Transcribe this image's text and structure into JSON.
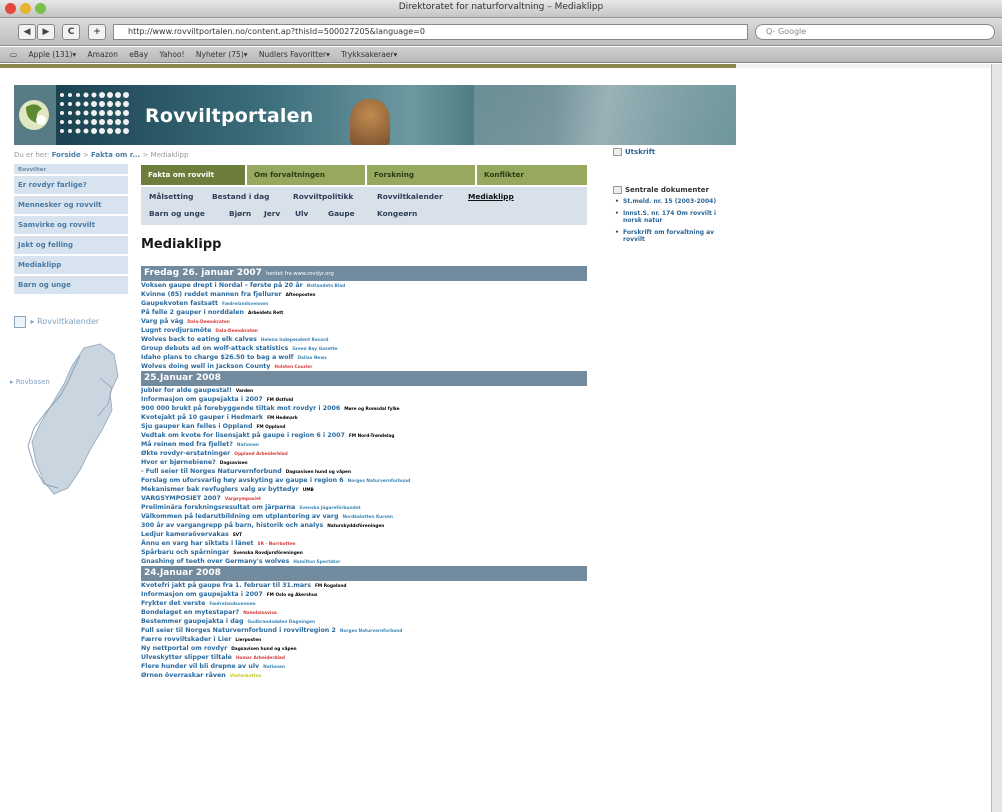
{
  "window": {
    "title": "Direktoratet for naturforvaltning – Mediaklipp"
  },
  "toolbar": {
    "back": "◀",
    "forward": "▶",
    "reload": "C",
    "add": "+",
    "url": "http://www.rovviltportalen.no/content.ap?thisId=500027205&language=0",
    "search_placeholder": "Q- Google"
  },
  "bookmarks": [
    "Apple (131)▾",
    "Amazon",
    "eBay",
    "Yahoo!",
    "Nyheter (75)▾",
    "Nudlers Favoritter▾",
    "Trykksakeraer▾"
  ],
  "banner": {
    "title": "Rovviltportalen"
  },
  "breadcrumb": {
    "prefix": "Du er her:",
    "home": "Forside",
    "sep1": " > ",
    "section": "Fakta om r...",
    "sep2": " > ",
    "current": "Mediaklipp"
  },
  "leftnav": {
    "small": "Rovvilter",
    "items": [
      "Er rovdyr farlige?",
      "Mennesker og rovvilt",
      "Samvirke og rovvilt",
      "Jakt og felling",
      "Mediaklipp",
      "Barn og unge"
    ]
  },
  "side": {
    "rovviltkalender": "Rovviltkalender",
    "rovbasen": "Rovbasen"
  },
  "tabs": [
    "Fakta om rovvilt",
    "Om forvaltningen",
    "Forskning",
    "Konflikter"
  ],
  "subtabs": {
    "row1": [
      "Målsetting",
      "Bestand i dag",
      "Rovviltpolitikk",
      "Rovviltkalender",
      "Mediaklipp"
    ],
    "row2": [
      "Barn og unge",
      "Bjørn",
      "Jerv",
      "Ulv",
      "Gaupe",
      "Kongeørn"
    ]
  },
  "main": {
    "title": "Mediaklipp"
  },
  "groups": [
    {
      "date": "Fredag 26. januar 2007",
      "source": "hentet fra www.rovdyr.org",
      "items": [
        {
          "t": "Voksen gaupe drept i Nordal – første på 20 år",
          "s": "Østlandets Blad",
          "c": "#3a86b4"
        },
        {
          "t": "Kvinne (85) reddet mannen fra fjellurer",
          "s": "Aftenposten",
          "c": "#000"
        },
        {
          "t": "Gaupekvoten fastsatt",
          "s": "Fædrelandsvennen",
          "c": "#3a86b4"
        },
        {
          "t": "På felle 2 gauper i norddalen",
          "s": "Arbeidets Rett",
          "c": "#000"
        },
        {
          "t": "Varg på väg",
          "s": "Dala-Demokraten",
          "c": "#d53a3a"
        },
        {
          "t": "Lugnt rovdjursmöte",
          "s": "Dala-Demokraten",
          "c": "#d53a3a"
        },
        {
          "t": "Wolves back to eating elk calves",
          "s": "Helena Independent Record",
          "c": "#3a86b4"
        },
        {
          "t": "Group debuts ad on wolf-attack statistics",
          "s": "Green Bay Gazette",
          "c": "#3a86b4"
        },
        {
          "t": "Idaho plans to charge $26.50 to bag a wolf",
          "s": "Dallas News",
          "c": "#3a86b4"
        },
        {
          "t": "Wolves doing well in Jackson County",
          "s": "Holsten Courier",
          "c": "#d53a3a"
        }
      ]
    },
    {
      "date": "25.Januar 2008",
      "source": "",
      "items": [
        {
          "t": "Jubler for alde gaupestal!",
          "s": "Varden",
          "c": "#000"
        },
        {
          "t": "Informasjon om gaupejakta i 2007",
          "s": "FM Østfold",
          "c": "#000"
        },
        {
          "t": "900 000 brukt på forebyggende tiltak mot rovdyr i 2006",
          "s": "Møre og Romsdal fylke",
          "c": "#000"
        },
        {
          "t": "Kvotejakt på 10 gauper i Hedmark",
          "s": "FM Hedmark",
          "c": "#000"
        },
        {
          "t": "Sju gauper kan felles i Oppland",
          "s": "FM Oppland",
          "c": "#000"
        },
        {
          "t": "Vedtak om kvote for lisensjakt på gaupe i region 6 i 2007",
          "s": "FM Nord-Trøndelag",
          "c": "#000"
        },
        {
          "t": "Må reinen med fra fjellet?",
          "s": "Nationen",
          "c": "#3a86b4"
        },
        {
          "t": "Økte rovdyr-erstatninger",
          "s": "Oppland Arbeiderblad",
          "c": "#d53a3a"
        },
        {
          "t": "Hvor er bjørnebiene?",
          "s": "Dagsavisen",
          "c": "#000"
        },
        {
          "t": "- Full seier til Norges Naturvernforbund",
          "s": "Dagsavisen hund og våpen",
          "c": "#000"
        },
        {
          "t": "Forslag om uforsvarlig høy avskyting av gaupe i region 6",
          "s": "Norges Naturvernforbund",
          "c": "#3a86b4"
        },
        {
          "t": "Mekanismer bak revfuglers valg av byttedyr",
          "s": "UMB",
          "c": "#000"
        },
        {
          "t": "VARGSYMPOSIET 2007",
          "s": "Vargsymposiet",
          "c": "#d53a3a"
        },
        {
          "t": "Preliminära forskningsresultat om järparna",
          "s": "Svenska Jägareförbundet",
          "c": "#3a86b4"
        },
        {
          "t": "Välkommen på ledarutbildning om utplantering av varg",
          "s": "Nordkalotten Kursen",
          "c": "#3a86b4"
        },
        {
          "t": "300 år av vargangrepp på barn, historik och analys",
          "s": "Naturskyddsföreningen",
          "c": "#000"
        },
        {
          "t": "Ledjur kameraövervakas",
          "s": "SVT",
          "c": "#000"
        },
        {
          "t": "Ännu en varg har siktats i länet",
          "s": "SR - Norrbotten",
          "c": "#d53a3a"
        },
        {
          "t": "Spårbaru och spårningar",
          "s": "Svenska Rovdjursföreningen",
          "c": "#000"
        },
        {
          "t": "Gnashing of teeth over Germany's wolves",
          "s": "Hamilton Spectator",
          "c": "#3a86b4"
        }
      ]
    },
    {
      "date": "24.Januar 2008",
      "source": "",
      "items": [
        {
          "t": "Kvotefri jakt på gaupe fra 1. februar til 31.mars",
          "s": "FM Rogaland",
          "c": "#000"
        },
        {
          "t": "Informasjon om gaupejakta i 2007",
          "s": "FM Oslo og Akershus",
          "c": "#000"
        },
        {
          "t": "Frykter det verste",
          "s": "Fædrelandsvennen",
          "c": "#3a86b4"
        },
        {
          "t": "Bondelaget en mytestapar?",
          "s": "Namdalsavisa",
          "c": "#d53a3a"
        },
        {
          "t": "Bestemmer gaupejakta i dag",
          "s": "Gudbrandsdølen Dagningen",
          "c": "#3a86b4"
        },
        {
          "t": "Full seier til Norges Naturvernforbund i rovviltregion 2",
          "s": "Norges Naturvernforbund",
          "c": "#3a86b4"
        },
        {
          "t": "Færre rovviltskader i Lier",
          "s": "Lierposten",
          "c": "#000"
        },
        {
          "t": "Ny nettportal om rovdyr",
          "s": "Dagsavisen hund og våpen",
          "c": "#000"
        },
        {
          "t": "Ulveskytter slipper tiltale",
          "s": "Hamar Arbeiderblad",
          "c": "#d53a3a"
        },
        {
          "t": "Flere hunder vil bli drepne av ulv",
          "s": "Nationen",
          "c": "#3a86b4"
        },
        {
          "t": "Ørnen överraskar råven",
          "s": "Västerbotten",
          "c": "#c6c620"
        }
      ]
    }
  ],
  "util": {
    "print": "Utskrift"
  },
  "docs": {
    "title": "Sentrale dokumenter",
    "items": [
      "St.meld. nr. 15 (2003-2004)",
      "Innst.S. nr. 174 Om rovvilt i norsk natur",
      "Forskrift om forvaltning av rovvilt"
    ]
  }
}
